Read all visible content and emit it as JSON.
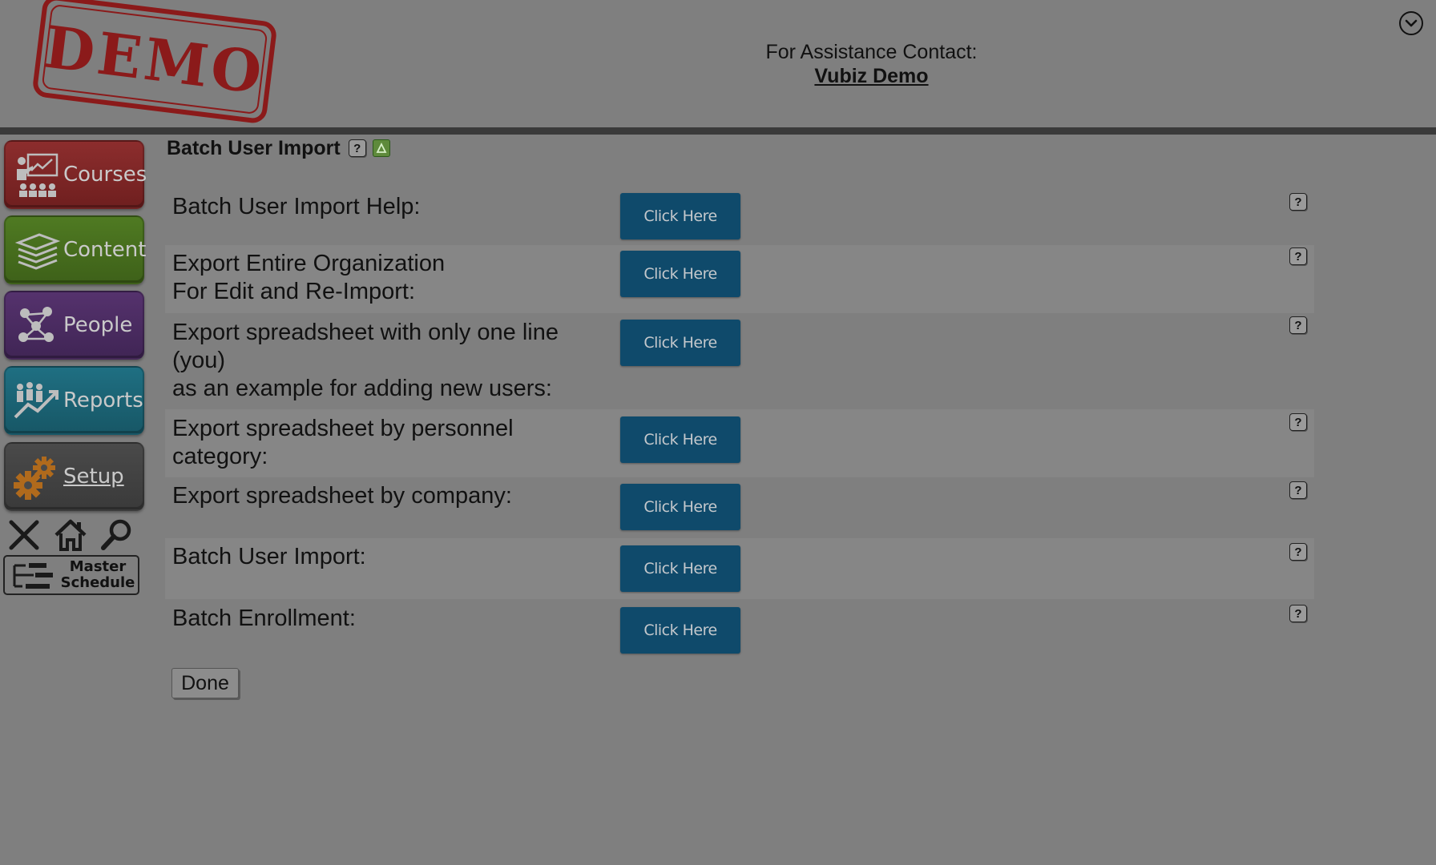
{
  "header": {
    "stamp_text": "DEMO",
    "assistance_label": "For Assistance Contact:",
    "contact_name": "Vubiz Demo",
    "collapse_icon": "chevron-down-circle-icon"
  },
  "sidebar": {
    "items": [
      {
        "label": "Courses",
        "icon": "presentation-icon",
        "color": "#8c2d2d"
      },
      {
        "label": "Content",
        "icon": "layers-icon",
        "color": "#4f7a22"
      },
      {
        "label": "People",
        "icon": "network-people-icon",
        "color": "#55326d"
      },
      {
        "label": "Reports",
        "icon": "chart-people-icon",
        "color": "#1f6f82"
      },
      {
        "label": "Setup",
        "icon": "gears-icon",
        "color": "#4a4a4a"
      }
    ],
    "tools": [
      {
        "name": "close",
        "icon": "close-icon"
      },
      {
        "name": "home",
        "icon": "home-icon"
      },
      {
        "name": "search",
        "icon": "search-icon"
      }
    ],
    "master_schedule": {
      "line1": "Master",
      "line2": "Schedule",
      "icon": "schedule-icon"
    }
  },
  "main": {
    "title": "Batch User Import",
    "help_glyph": "?",
    "button_label": "Click Here",
    "button_color": "#0f4a6b",
    "rows": [
      {
        "lines": [
          "Batch User Import Help:"
        ]
      },
      {
        "lines": [
          "Export Entire Organization",
          "For Edit and Re-Import:"
        ]
      },
      {
        "lines": [
          "Export spreadsheet with only one line",
          "(you)",
          "as an example for adding new users:"
        ]
      },
      {
        "lines": [
          "Export spreadsheet by personnel",
          "category:"
        ]
      },
      {
        "lines": [
          "Export spreadsheet by company:"
        ]
      },
      {
        "lines": [
          "Batch User Import:"
        ]
      },
      {
        "lines": [
          "Batch Enrollment:"
        ]
      }
    ],
    "done_label": "Done"
  }
}
